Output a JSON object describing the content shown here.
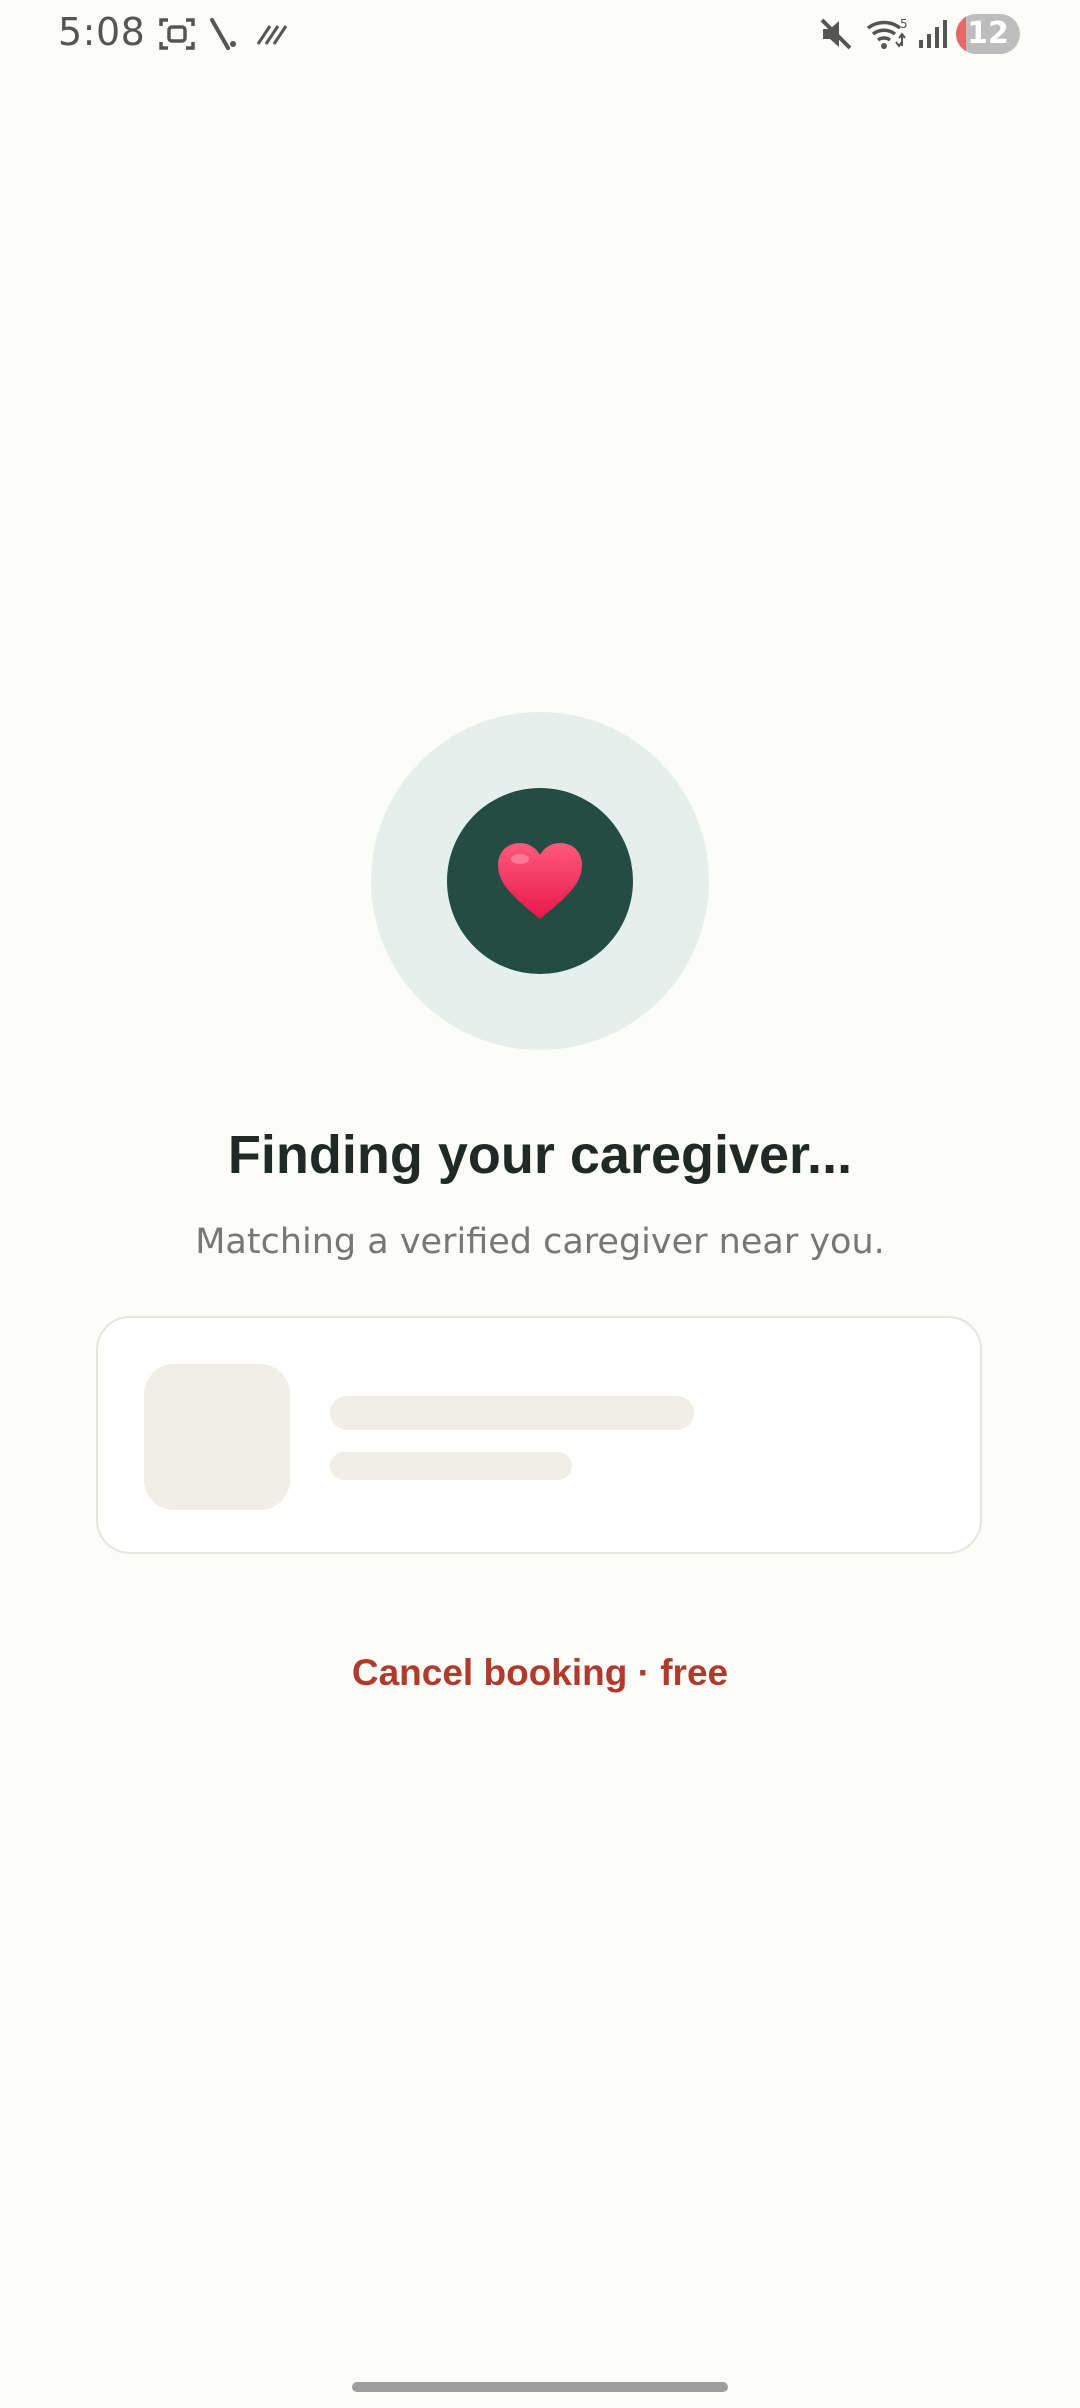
{
  "status_bar": {
    "time": "5:08",
    "battery_level": "12",
    "icons": [
      "screenshot-icon",
      "signal-slash-icon",
      "data-saver-icon",
      "mute-icon",
      "wifi-icon",
      "cellular-signal-icon",
      "battery-icon"
    ],
    "wifi_label": "5"
  },
  "main": {
    "title": "Finding your caregiver...",
    "subtitle": "Matching a verified caregiver near you.",
    "center_icon": "heart-icon",
    "cancel_label": "Cancel booking · free"
  },
  "colors": {
    "background": "#FCFCF8",
    "halo": "#E5EFEC",
    "core": "#234D43",
    "heart": "#F4305F",
    "title": "#1F2A26",
    "subtitle": "#777873",
    "cancel": "#B13A2E",
    "skeleton": "#F0EEE5"
  }
}
